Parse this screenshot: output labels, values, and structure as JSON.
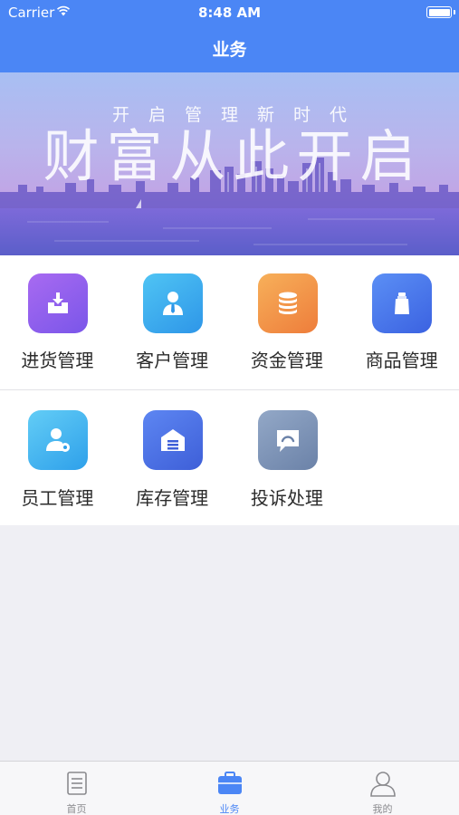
{
  "status_bar": {
    "carrier": "Carrier",
    "time": "8:48 AM"
  },
  "nav": {
    "title": "业务"
  },
  "banner": {
    "subtitle": "开启管理新时代",
    "headline": "财富从此开启"
  },
  "grid": {
    "rows": [
      [
        {
          "label": "进货管理",
          "icon": "inbox-download-icon"
        },
        {
          "label": "客户管理",
          "icon": "person-tie-icon"
        },
        {
          "label": "资金管理",
          "icon": "coin-stack-icon"
        },
        {
          "label": "商品管理",
          "icon": "product-bottle-icon"
        }
      ],
      [
        {
          "label": "员工管理",
          "icon": "employee-gear-icon"
        },
        {
          "label": "库存管理",
          "icon": "warehouse-icon"
        },
        {
          "label": "投诉处理",
          "icon": "complaint-chat-icon"
        }
      ]
    ]
  },
  "tabbar": {
    "items": [
      {
        "label": "首页",
        "icon": "document-icon",
        "active": false
      },
      {
        "label": "业务",
        "icon": "briefcase-icon",
        "active": true
      },
      {
        "label": "我的",
        "icon": "user-icon",
        "active": false
      }
    ]
  },
  "colors": {
    "primary": "#4b86f5",
    "background": "#efeff4",
    "tab_inactive": "#8a8a8e"
  }
}
